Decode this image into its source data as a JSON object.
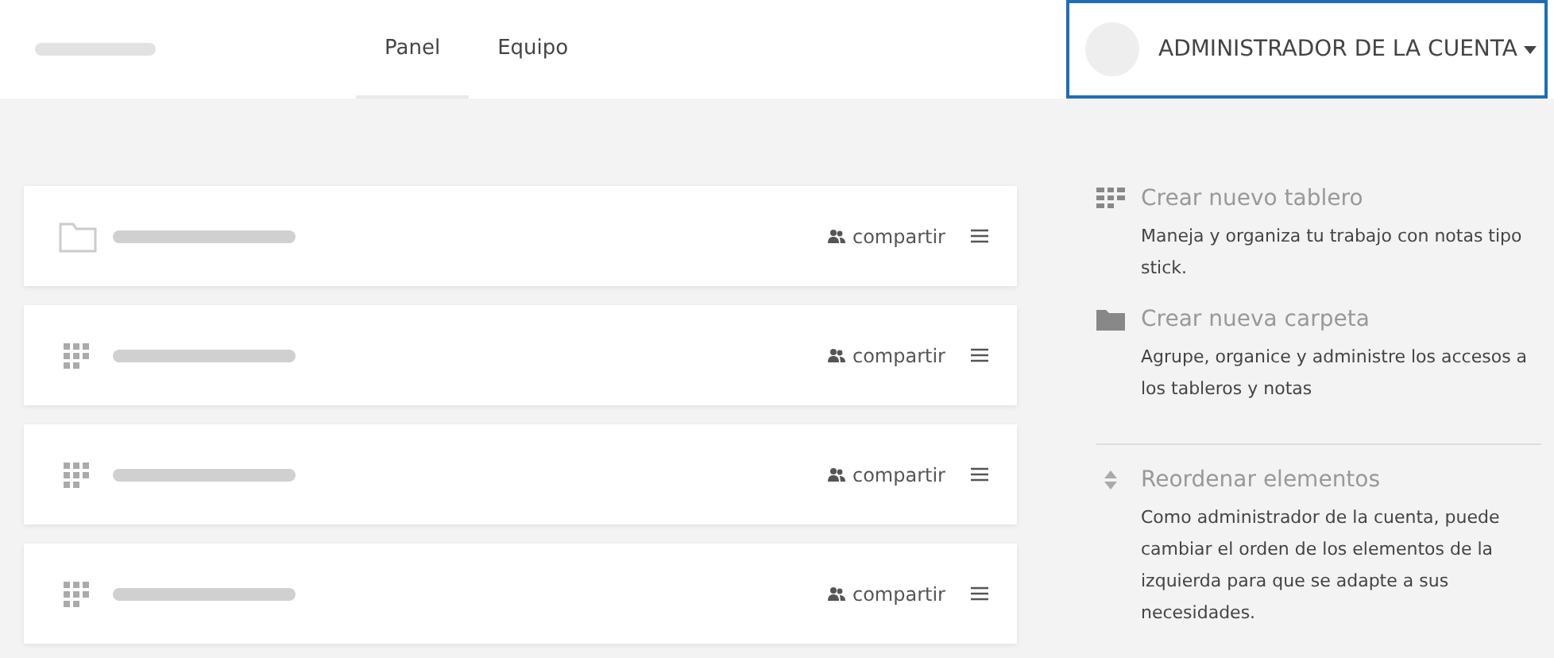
{
  "header": {
    "tabs": [
      {
        "label": "Panel",
        "selected": true
      },
      {
        "label": "Equipo",
        "selected": false
      }
    ],
    "account": {
      "label": "ADMINISTRADOR DE LA CUENTA"
    }
  },
  "items": [
    {
      "kind": "folder",
      "share": "compartir"
    },
    {
      "kind": "board",
      "share": "compartir"
    },
    {
      "kind": "board",
      "share": "compartir"
    },
    {
      "kind": "board",
      "share": "compartir"
    }
  ],
  "sidebar": [
    {
      "kind": "board",
      "title": "Crear nuevo tablero",
      "text": "Maneja y organiza tu trabajo con notas tipo stick."
    },
    {
      "kind": "folder",
      "title": "Crear nueva carpeta",
      "text": "Agrupe, organice y administre los accesos a los tableros y notas"
    },
    {
      "kind": "reorder",
      "title": "Reordenar elementos",
      "text": "Como administrador de la cuenta, puede cambiar el orden de los elementos de la izquierda para que se adapte a sus necesidades."
    }
  ]
}
